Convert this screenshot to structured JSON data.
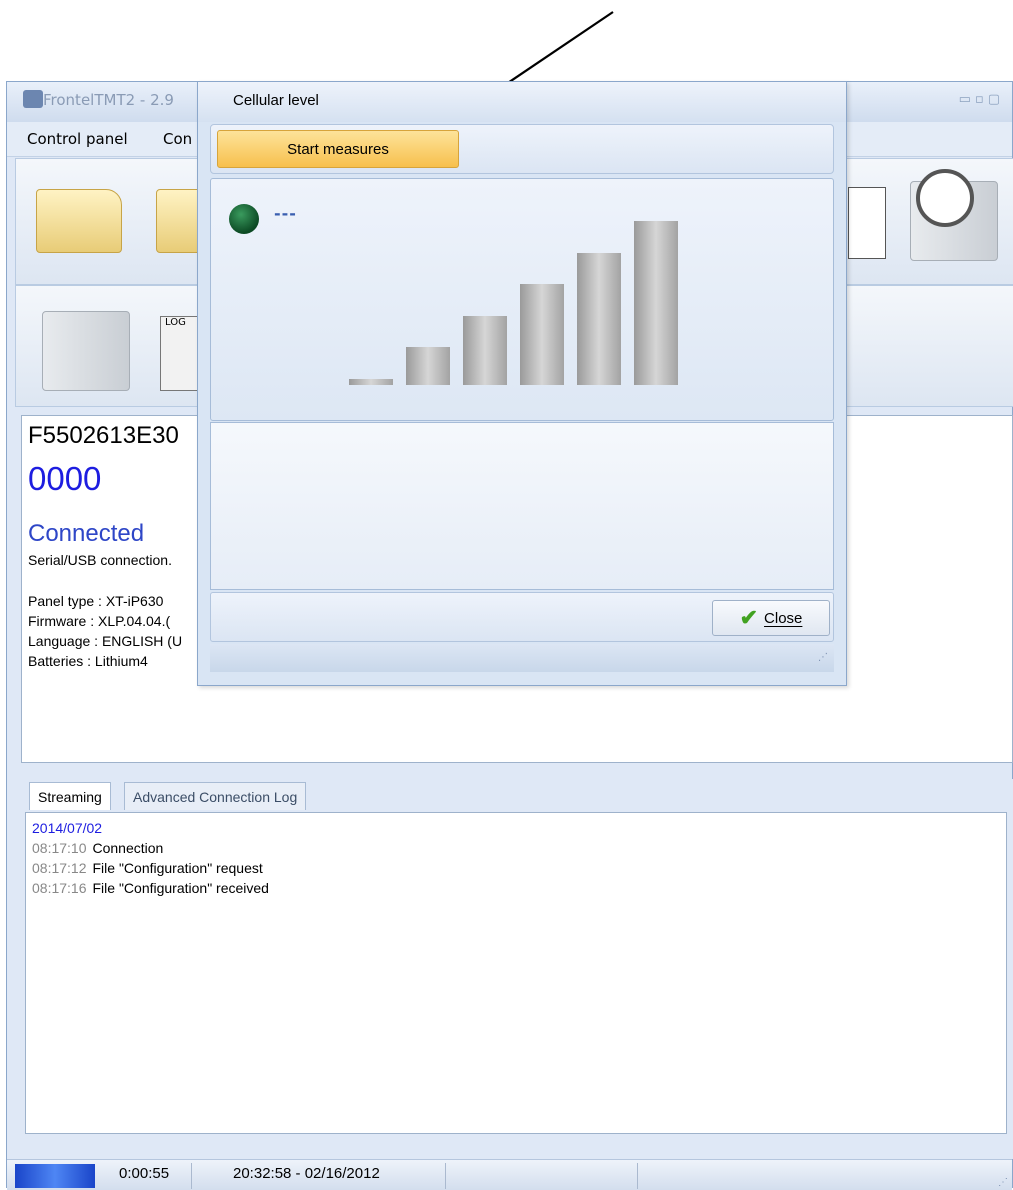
{
  "app": {
    "title": "FrontelTMT2 - 2.9",
    "window_controls": "▭▫▢"
  },
  "menu": {
    "items": [
      "Control panel",
      "Con"
    ]
  },
  "info": {
    "serial": "F5502613E30",
    "code": "0000",
    "status": "Connected",
    "connection": "Serial/USB connection.",
    "panel_type": "Panel type : XT-iP630",
    "firmware": "Firmware : XLP.04.04.(",
    "language": "Language : ENGLISH (U",
    "batteries": "Batteries : Lithium4"
  },
  "tabs": {
    "streaming": "Streaming",
    "advanced": "Advanced Connection Log"
  },
  "log": {
    "date": "2014/07/02",
    "entries": [
      {
        "time": "08:17:10",
        "text": "Connection"
      },
      {
        "time": "08:17:12",
        "text": "File \"Configuration\" request"
      },
      {
        "time": "08:17:16",
        "text": "File \"Configuration\" received"
      }
    ]
  },
  "statusbar": {
    "elapsed": "0:00:55",
    "datetime": "20:32:58 - 02/16/2012"
  },
  "dialog": {
    "title": "Cellular level",
    "start_label": "Start measures",
    "level_text": "---",
    "close_label": "Close",
    "signal_bars": 6,
    "led_color": "#0c4a24"
  }
}
